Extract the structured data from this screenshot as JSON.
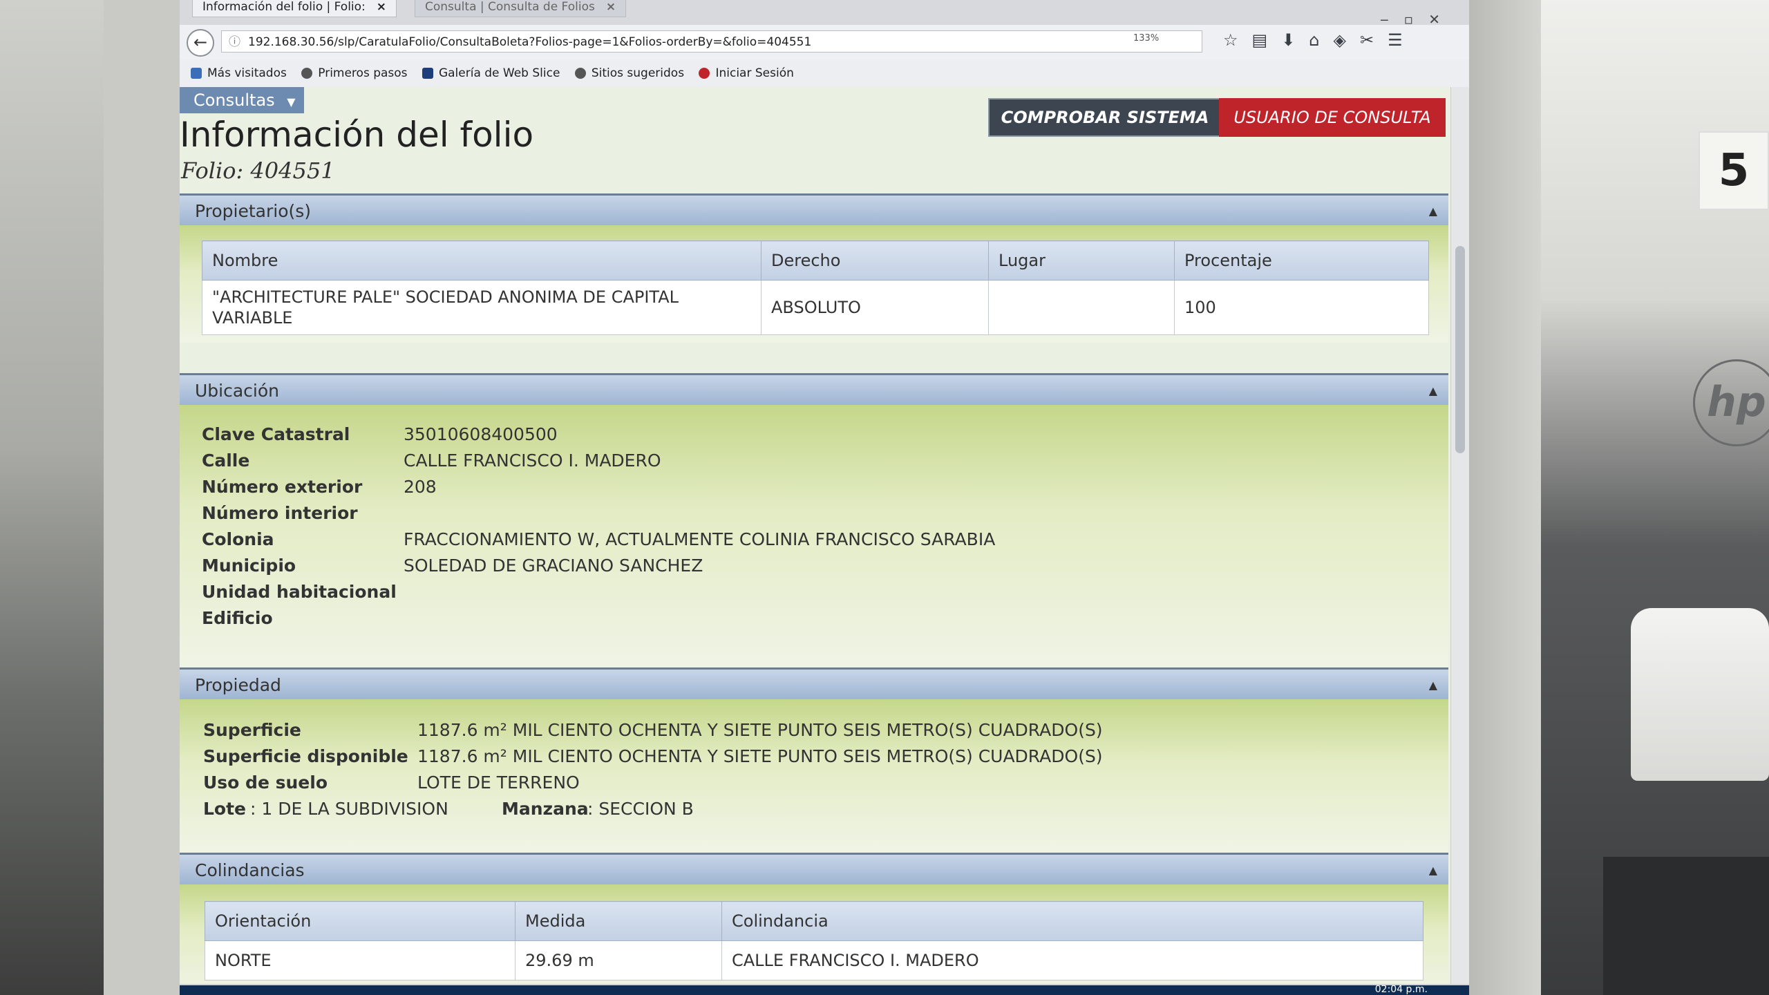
{
  "browser": {
    "tabs": [
      {
        "label": "Información del folio | Folio:",
        "close": "×"
      },
      {
        "label": "Consulta | Consulta de Folios",
        "close": "×"
      }
    ],
    "url": "192.168.30.56/slp/CaratulaFolio/ConsultaBoleta?Folios-page=1&Folios-orderBy=&folio=404551",
    "zoom": "133%",
    "bookmarks": [
      "Más visitados",
      "Primeros pasos",
      "Galería de Web Slice",
      "Sitios sugeridos",
      "Iniciar Sesión"
    ],
    "clock": "02:04 p.m."
  },
  "header": {
    "menu": "Consultas",
    "comprobar": "COMPROBAR SISTEMA",
    "usuario": "USUARIO DE CONSULTA",
    "title": "Información del folio",
    "folio": "Folio: 404551"
  },
  "propietarios": {
    "title": "Propietario(s)",
    "columns": [
      "Nombre",
      "Derecho",
      "Lugar",
      "Procentaje"
    ],
    "rows": [
      [
        "\"ARCHITECTURE PALE\" SOCIEDAD ANONIMA DE CAPITAL VARIABLE",
        "ABSOLUTO",
        "",
        "100"
      ]
    ]
  },
  "ubicacion": {
    "title": "Ubicación",
    "fields": [
      {
        "label": "Clave Catastral",
        "value": "35010608400500"
      },
      {
        "label": "Calle",
        "value": "CALLE FRANCISCO I. MADERO"
      },
      {
        "label": "Número exterior",
        "value": "208"
      },
      {
        "label": "Número interior",
        "value": ""
      },
      {
        "label": "Colonia",
        "value": "FRACCIONAMIENTO W, ACTUALMENTE COLINIA FRANCISCO SARABIA"
      },
      {
        "label": "Municipio",
        "value": "SOLEDAD DE GRACIANO SANCHEZ"
      },
      {
        "label": "Unidad habitacional",
        "value": ""
      },
      {
        "label": "Edificio",
        "value": ""
      }
    ]
  },
  "propiedad": {
    "title": "Propiedad",
    "fields": [
      {
        "label": "Superficie",
        "value": "1187.6 m² MIL CIENTO OCHENTA Y SIETE PUNTO SEIS METRO(S) CUADRADO(S)"
      },
      {
        "label": "Superficie disponible",
        "value": "1187.6 m² MIL CIENTO OCHENTA Y SIETE PUNTO SEIS METRO(S) CUADRADO(S)"
      },
      {
        "label": "Uso de suelo",
        "value": "LOTE DE TERRENO"
      }
    ],
    "lote_label": "Lote",
    "lote_value": ": 1 DE LA SUBDIVISION",
    "manzana_label": "Manzana",
    "manzana_value": ": SECCION B"
  },
  "colindancias": {
    "title": "Colindancias",
    "columns": [
      "Orientación",
      "Medida",
      "Colindancia"
    ],
    "rows": [
      [
        "NORTE",
        "29.69 m",
        "CALLE FRANCISCO I. MADERO"
      ]
    ]
  },
  "sticker_number": "5"
}
